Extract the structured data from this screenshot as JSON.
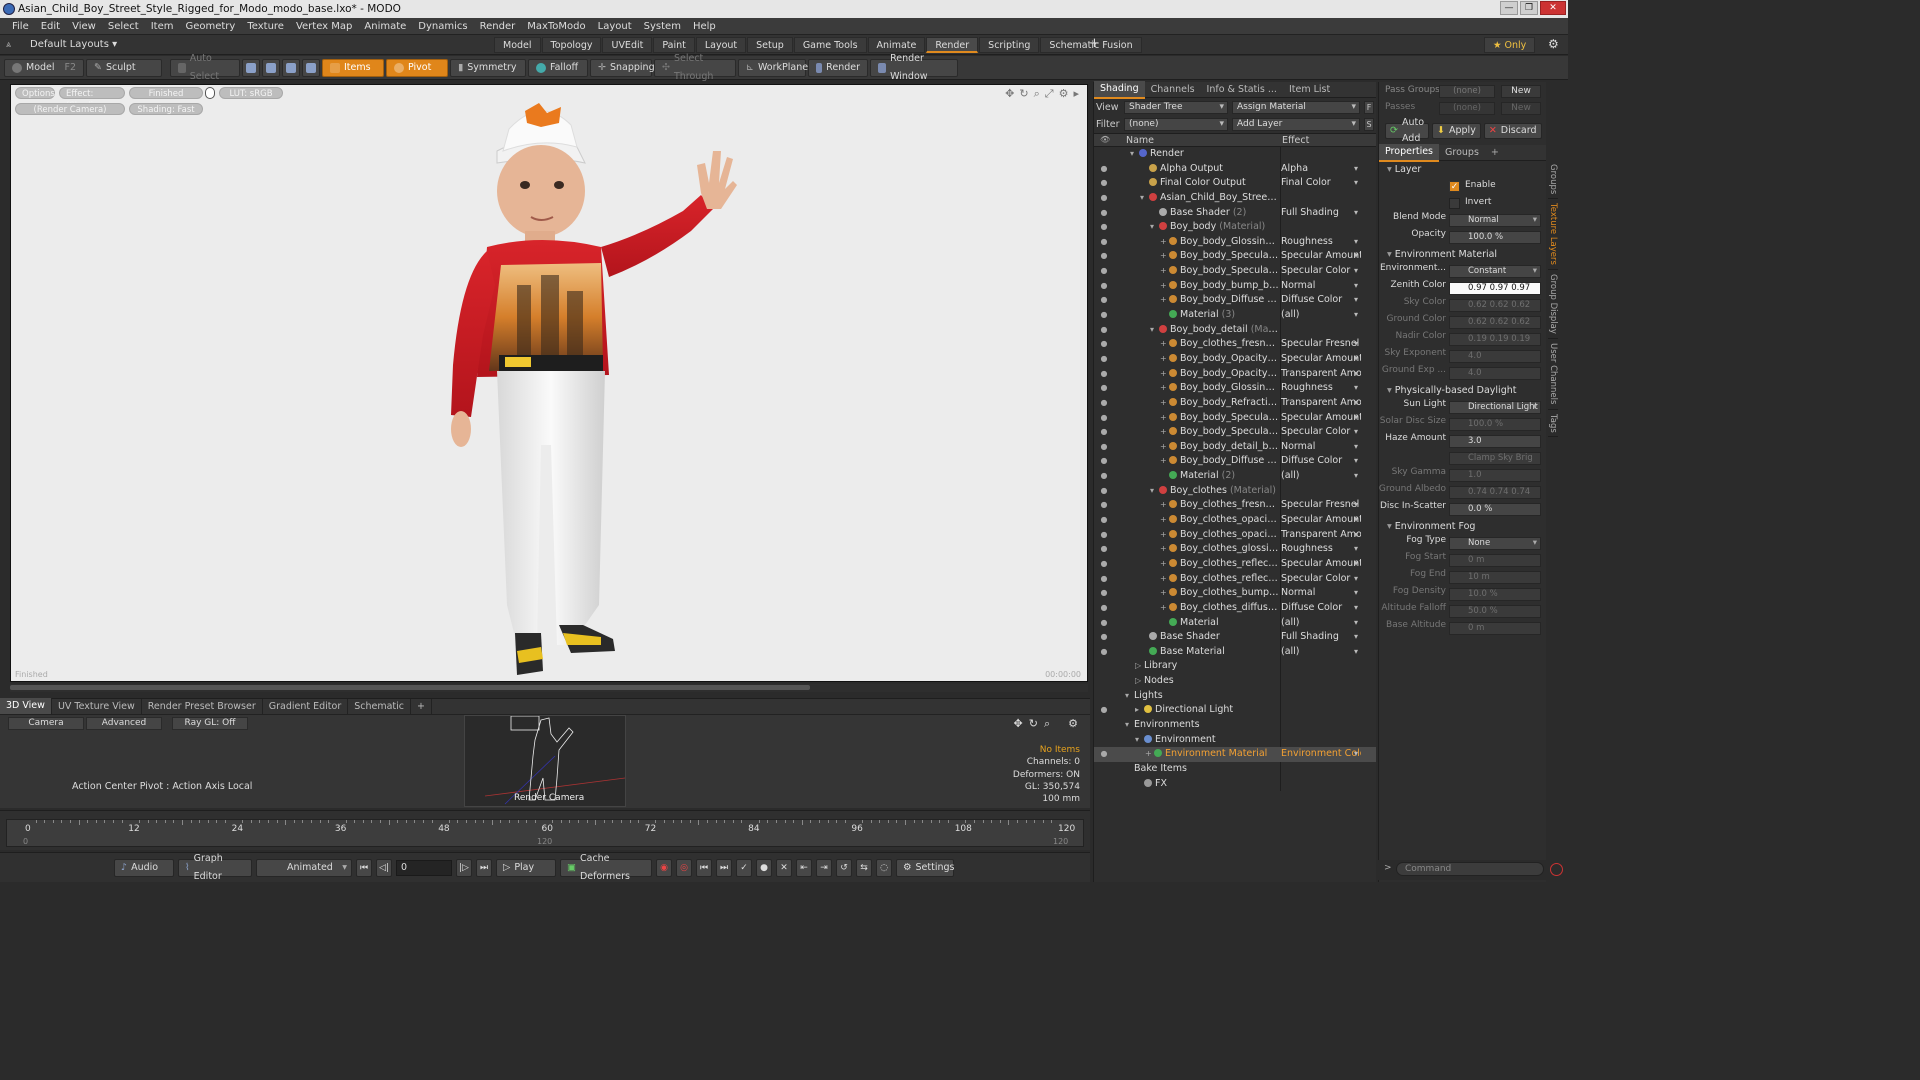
{
  "window": {
    "title": "Asian_Child_Boy_Street_Style_Rigged_for_Modo_modo_base.lxo* - MODO",
    "min": "—",
    "max": "❐",
    "close": "✕"
  },
  "menu": [
    "File",
    "Edit",
    "View",
    "Select",
    "Item",
    "Geometry",
    "Texture",
    "Vertex Map",
    "Animate",
    "Dynamics",
    "Render",
    "MaxToModo",
    "Layout",
    "System",
    "Help"
  ],
  "layout": {
    "default": "Default Layouts ▾",
    "tabs": [
      "Model",
      "Topology",
      "UVEdit",
      "Paint",
      "Layout",
      "Setup",
      "Game Tools",
      "Animate",
      "Render",
      "Scripting",
      "Schematic Fusion"
    ],
    "plus": "+",
    "only": "★ Only"
  },
  "toolbar": {
    "model": "Model",
    "model_key": "F2",
    "sculpt": "Sculpt",
    "auto_select": "Auto Select",
    "items": "Items",
    "pivot": "Pivot",
    "symmetry": "Symmetry",
    "falloff": "Falloff",
    "snapping": "Snapping",
    "select_through": "Select Through",
    "workplane": "WorkPlane",
    "render": "Render",
    "render_window": "Render Window"
  },
  "viewport": {
    "options": "Options",
    "effect": "Effect: (Shadi...",
    "finished": "Finished",
    "lut": "LUT: sRGB",
    "camera": "(Render Camera)",
    "shading": "Shading: Fast",
    "corner_bl": "Finished",
    "corner_br": "00:00:00"
  },
  "bottom_tabs": [
    "3D View",
    "UV Texture View",
    "Render Preset Browser",
    "Gradient Editor",
    "Schematic"
  ],
  "miniview": {
    "camera": "Camera",
    "advanced": "Advanced",
    "raygl": "Ray GL: Off",
    "action": "Action Center Pivot : Action Axis Local",
    "render_camera": "Render Camera",
    "no_items": "No Items",
    "channels": "Channels: 0",
    "deformers": "Deformers: ON",
    "gl": "GL: 350,574",
    "scale": "100 mm"
  },
  "timeline": {
    "ticks": [
      "0",
      "12",
      "24",
      "36",
      "48",
      "60",
      "72",
      "84",
      "96",
      "108",
      "120"
    ],
    "sub_start": "0",
    "sub_mid": "120",
    "sub_end": "120"
  },
  "playbar": {
    "audio": "Audio",
    "graph_editor": "Graph Editor",
    "animated": "Animated",
    "frame": "0",
    "play": "Play",
    "cache": "Cache Deformers",
    "settings": "Settings"
  },
  "shading": {
    "tabs": [
      "Shading",
      "Channels",
      "Info & Statis ...",
      "Item List"
    ],
    "view_label": "View",
    "view_value": "Shader Tree",
    "assign": "Assign Material",
    "f_btn": "F",
    "filter_label": "Filter",
    "filter_value": "(none)",
    "add_layer": "Add Layer",
    "s_btn": "S",
    "col_name": "Name",
    "col_effect": "Effect",
    "rows": [
      {
        "d": 0,
        "n": "Render",
        "e": "",
        "t": "▾",
        "c": "#5566cc",
        "eye": ""
      },
      {
        "d": 1,
        "n": "Alpha Output",
        "e": "Alpha",
        "t": "",
        "c": "#c9a24a",
        "eye": "●"
      },
      {
        "d": 1,
        "n": "Final Color Output",
        "e": "Final Color",
        "t": "",
        "c": "#c9a24a",
        "eye": "●"
      },
      {
        "d": 1,
        "n": "Asian_Child_Boy_Street_St...",
        "e": "",
        "t": "▾",
        "c": "#d04040",
        "eye": "●"
      },
      {
        "d": 2,
        "n": "Base Shader",
        "sub": "(2)",
        "e": "Full Shading",
        "t": "",
        "c": "#aaaaaa",
        "eye": "●"
      },
      {
        "d": 2,
        "n": "Boy_body",
        "sub": "(Material)",
        "e": "",
        "t": "▾",
        "c": "#d04040",
        "eye": "●"
      },
      {
        "d": 3,
        "n": "Boy_body_Glossiness",
        "sub": "...",
        "e": "Roughness",
        "t": "+",
        "c": "#cc8a33",
        "eye": "●"
      },
      {
        "d": 3,
        "n": "Boy_body_Specular",
        "sub": "(I...",
        "e": "Specular Amount",
        "t": "+",
        "c": "#cc8a33",
        "eye": "●"
      },
      {
        "d": 3,
        "n": "Boy_body_Specular",
        "sub": "(I...",
        "e": "Specular Color",
        "t": "+",
        "c": "#cc8a33",
        "eye": "●"
      },
      {
        "d": 3,
        "n": "Boy_body_bump_bake...",
        "e": "Normal",
        "t": "+",
        "c": "#cc8a33",
        "eye": "●"
      },
      {
        "d": 3,
        "n": "Boy_body_Diffuse",
        "sub": "(Im...",
        "e": "Diffuse Color",
        "t": "+",
        "c": "#cc8a33",
        "eye": "●"
      },
      {
        "d": 3,
        "n": "Material",
        "sub": "(3)",
        "e": "(all)",
        "t": "",
        "c": "#44aa55",
        "eye": "●"
      },
      {
        "d": 2,
        "n": "Boy_body_detail",
        "sub": "(Material)",
        "e": "",
        "t": "▾",
        "c": "#d04040",
        "eye": "●"
      },
      {
        "d": 3,
        "n": "Boy_clothes_fresnel",
        "sub": "(...",
        "e": "Specular Fresnel",
        "t": "+",
        "c": "#cc8a33",
        "eye": "●"
      },
      {
        "d": 3,
        "n": "Boy_body_Opacity",
        "sub": "(I...",
        "e": "Specular Amount",
        "t": "+",
        "c": "#cc8a33",
        "eye": "●"
      },
      {
        "d": 3,
        "n": "Boy_body_Opacity",
        "sub": "(I...",
        "e": "Transparent Amo...",
        "t": "+",
        "c": "#cc8a33",
        "eye": "●"
      },
      {
        "d": 3,
        "n": "Boy_body_Glossiness",
        "sub": "...",
        "e": "Roughness",
        "t": "+",
        "c": "#cc8a33",
        "eye": "●"
      },
      {
        "d": 3,
        "n": "Boy_body_Refraction",
        "sub": "...",
        "e": "Transparent Amo...",
        "t": "+",
        "c": "#cc8a33",
        "eye": "●"
      },
      {
        "d": 3,
        "n": "Boy_body_Specular",
        "sub": "(I...",
        "e": "Specular Amount",
        "t": "+",
        "c": "#cc8a33",
        "eye": "●"
      },
      {
        "d": 3,
        "n": "Boy_body_Specular",
        "sub": "(I...",
        "e": "Specular Color",
        "t": "+",
        "c": "#cc8a33",
        "eye": "●"
      },
      {
        "d": 3,
        "n": "Boy_body_detail_bum",
        "sub": "...",
        "e": "Normal",
        "t": "+",
        "c": "#cc8a33",
        "eye": "●"
      },
      {
        "d": 3,
        "n": "Boy_body_Diffuse",
        "sub": "(Im...",
        "e": "Diffuse Color",
        "t": "+",
        "c": "#cc8a33",
        "eye": "●"
      },
      {
        "d": 3,
        "n": "Material",
        "sub": "(2)",
        "e": "(all)",
        "t": "",
        "c": "#44aa55",
        "eye": "●"
      },
      {
        "d": 2,
        "n": "Boy_clothes",
        "sub": "(Material)",
        "e": "",
        "t": "▾",
        "c": "#d04040",
        "eye": "●"
      },
      {
        "d": 3,
        "n": "Boy_clothes_fresnel",
        "sub": "(...",
        "e": "Specular Fresnel",
        "t": "+",
        "c": "#cc8a33",
        "eye": "●"
      },
      {
        "d": 3,
        "n": "Boy_clothes_opacity",
        "sub": "(...",
        "e": "Specular Amount",
        "t": "+",
        "c": "#cc8a33",
        "eye": "●"
      },
      {
        "d": 3,
        "n": "Boy_clothes_opacity",
        "sub": "(...",
        "e": "Transparent Amo...",
        "t": "+",
        "c": "#cc8a33",
        "eye": "●"
      },
      {
        "d": 3,
        "n": "Boy_clothes_glossines",
        "sub": "...",
        "e": "Roughness",
        "t": "+",
        "c": "#cc8a33",
        "eye": "●"
      },
      {
        "d": 3,
        "n": "Boy_clothes_reflection...",
        "e": "Specular Amount",
        "t": "+",
        "c": "#cc8a33",
        "eye": "●"
      },
      {
        "d": 3,
        "n": "Boy_clothes_reflection...",
        "e": "Specular Color",
        "t": "+",
        "c": "#cc8a33",
        "eye": "●"
      },
      {
        "d": 3,
        "n": "Boy_clothes_bump_ba...",
        "e": "Normal",
        "t": "+",
        "c": "#cc8a33",
        "eye": "●"
      },
      {
        "d": 3,
        "n": "Boy_clothes_diffuse",
        "sub": "(I...",
        "e": "Diffuse Color",
        "t": "+",
        "c": "#cc8a33",
        "eye": "●"
      },
      {
        "d": 3,
        "n": "Material",
        "e": "(all)",
        "t": "",
        "c": "#44aa55",
        "eye": "●"
      },
      {
        "d": 1,
        "n": "Base Shader",
        "e": "Full Shading",
        "t": "",
        "c": "#aaaaaa",
        "eye": "●"
      },
      {
        "d": 1,
        "n": "Base Material",
        "e": "(all)",
        "t": "",
        "c": "#44aa55",
        "eye": "●"
      },
      {
        "d": 0.5,
        "n": "Library",
        "e": "",
        "t": "▷",
        "c": "",
        "eye": ""
      },
      {
        "d": 0.5,
        "n": "Nodes",
        "e": "",
        "t": "▷",
        "c": "",
        "eye": ""
      },
      {
        "d": -0.5,
        "n": "Lights",
        "e": "",
        "t": "▾",
        "c": "",
        "eye": ""
      },
      {
        "d": 0.5,
        "n": "Directional Light",
        "e": "",
        "t": "▸",
        "c": "#e0c040",
        "eye": "●"
      },
      {
        "d": -0.5,
        "n": "Environments",
        "e": "",
        "t": "▾",
        "c": "",
        "eye": ""
      },
      {
        "d": 0.5,
        "n": "Environment",
        "e": "",
        "t": "▾",
        "c": "#6a8fd0",
        "eye": ""
      },
      {
        "d": 1.5,
        "n": "Environment Material",
        "e": "Environment Color",
        "t": "+",
        "c": "#44aa55",
        "eye": "●",
        "sel": true
      },
      {
        "d": -0.5,
        "n": "Bake Items",
        "e": "",
        "t": "",
        "c": "",
        "eye": ""
      },
      {
        "d": 0.5,
        "n": "FX",
        "e": "",
        "t": "",
        "c": "#999999",
        "eye": ""
      }
    ]
  },
  "props": {
    "pass_groups": "Pass Groups",
    "pass_none": "(none)",
    "new": "New",
    "passes": "Passes",
    "passes_none": "(none)",
    "new2": "New",
    "auto_add": "Auto Add",
    "apply": "Apply",
    "discard": "Discard",
    "tabs": [
      "Properties",
      "Groups"
    ],
    "layer": "Layer",
    "enable": "Enable",
    "invert": "Invert",
    "fields": [
      {
        "l": "Blend Mode",
        "v": "Normal",
        "drop": true
      },
      {
        "l": "Opacity",
        "v": "100.0 %"
      }
    ],
    "env_material": "Environment Material",
    "env_fields": [
      {
        "l": "Environment...",
        "v": "Constant",
        "drop": true
      },
      {
        "l": "Zenith Color",
        "v": "0.97  0.97  0.97",
        "white": true
      },
      {
        "l": "Sky Color",
        "v": "0.62  0.62  0.62",
        "dim": true
      },
      {
        "l": "Ground Color",
        "v": "0.62  0.62  0.62",
        "dim": true
      },
      {
        "l": "Nadir Color",
        "v": "0.19  0.19  0.19",
        "dim": true
      },
      {
        "l": "Sky Exponent",
        "v": "4.0",
        "dim": true
      },
      {
        "l": "Ground Exp ...",
        "v": "4.0",
        "dim": true
      }
    ],
    "daylight": "Physically-based Daylight",
    "day_fields": [
      {
        "l": "Sun Light",
        "v": "Directional Light",
        "drop": true
      },
      {
        "l": "Solar Disc Size",
        "v": "100.0 %",
        "dim": true
      },
      {
        "l": "Haze Amount",
        "v": "3.0"
      },
      {
        "l": "",
        "v": "Clamp Sky Brig ...",
        "dim": true
      },
      {
        "l": "Sky Gamma",
        "v": "1.0",
        "dim": true
      },
      {
        "l": "Ground Albedo",
        "v": "0.74  0.74  0.74",
        "dim": true
      },
      {
        "l": "Disc In-Scatter",
        "v": "0.0 %"
      }
    ],
    "fog": "Environment Fog",
    "fog_fields": [
      {
        "l": "Fog Type",
        "v": "None",
        "drop": true
      },
      {
        "l": "Fog Start",
        "v": "0 m",
        "dim": true
      },
      {
        "l": "Fog End",
        "v": "10 m",
        "dim": true
      },
      {
        "l": "Fog Density",
        "v": "10.0 %",
        "dim": true
      },
      {
        "l": "Altitude Falloff",
        "v": "50.0 %",
        "dim": true
      },
      {
        "l": "Base Altitude",
        "v": "0 m",
        "dim": true
      }
    ],
    "vtabs": [
      "Groups",
      "Texture Layers",
      "Group Display",
      "User Channels",
      "Tags"
    ],
    "command": "Command"
  },
  "colors": {
    "accent": "#e0861a",
    "selected": "#f2a033",
    "viewport_bg": "#ececec"
  }
}
